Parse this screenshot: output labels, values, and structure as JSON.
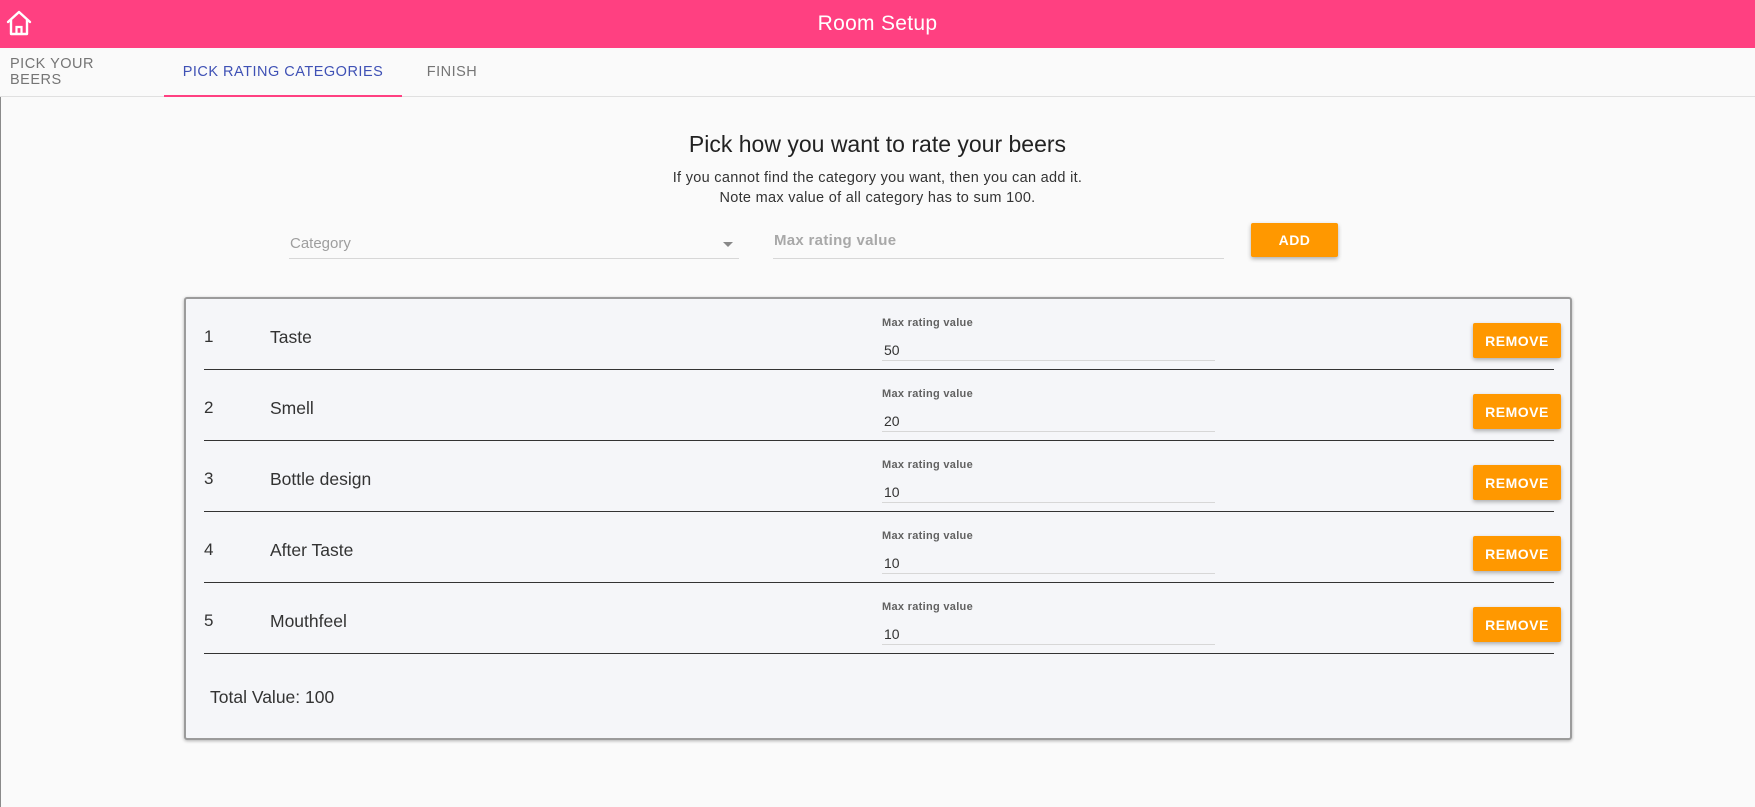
{
  "appbar": {
    "title": "Room Setup",
    "home_icon": "home-icon",
    "color": "#ff4081"
  },
  "tabs": [
    {
      "label": "PICK YOUR BEERS"
    },
    {
      "label": "PICK RATING CATEGORIES"
    },
    {
      "label": "FINISH"
    }
  ],
  "main": {
    "heading": "Pick how you want to rate your beers",
    "sub1": "If you cannot find the category you want, then you can add it.",
    "sub2": "Note max value of all category has to sum 100.",
    "category_placeholder": "Category",
    "max_placeholder": "Max rating value",
    "add_label": "ADD"
  },
  "categories": [
    {
      "num": "1",
      "name": "Taste",
      "field_label": "Max rating value",
      "value": "50",
      "remove_label": "REMOVE"
    },
    {
      "num": "2",
      "name": "Smell",
      "field_label": "Max rating value",
      "value": "20",
      "remove_label": "REMOVE"
    },
    {
      "num": "3",
      "name": "Bottle design",
      "field_label": "Max rating value",
      "value": "10",
      "remove_label": "REMOVE"
    },
    {
      "num": "4",
      "name": "After Taste",
      "field_label": "Max rating value",
      "value": "10",
      "remove_label": "REMOVE"
    },
    {
      "num": "5",
      "name": "Mouthfeel",
      "field_label": "Max rating value",
      "value": "10",
      "remove_label": "REMOVE"
    }
  ],
  "total_label": "Total Value: 100",
  "colors": {
    "accent": "#ff9800",
    "active_tab": "#3f51b5"
  }
}
